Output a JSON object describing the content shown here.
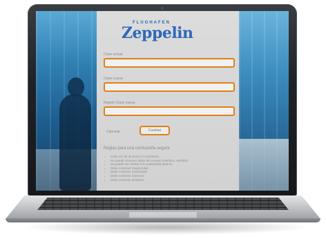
{
  "brand": {
    "logo_top": "FLUGHAFEN",
    "logo_main": "Zeppelin"
  },
  "form": {
    "fields": [
      {
        "label": "Clave actual",
        "value": "",
        "placeholder": ""
      },
      {
        "label": "Clave nueva",
        "value": "",
        "placeholder": ""
      },
      {
        "label": "Repetir Clave nueva",
        "value": "",
        "placeholder": ""
      }
    ],
    "cancel_label": "Cancelar",
    "submit_label": "Cambiar"
  },
  "rules": {
    "title": "Reglas para una contraseña segura",
    "items": [
      "Debe ser de al menos 8 caracteres",
      "No puede contener datos del usuario (Nombre, Apellido)",
      "No puede ser similar a la contraseña anterior",
      "Debe contener mayúsculas",
      "Debe contener minúsculas",
      "Debe contener números",
      "Debe contener símbolos"
    ]
  },
  "colors": {
    "highlight": "#e07f17",
    "panel": "#d6d6d6",
    "logo": "#2f68b7"
  }
}
